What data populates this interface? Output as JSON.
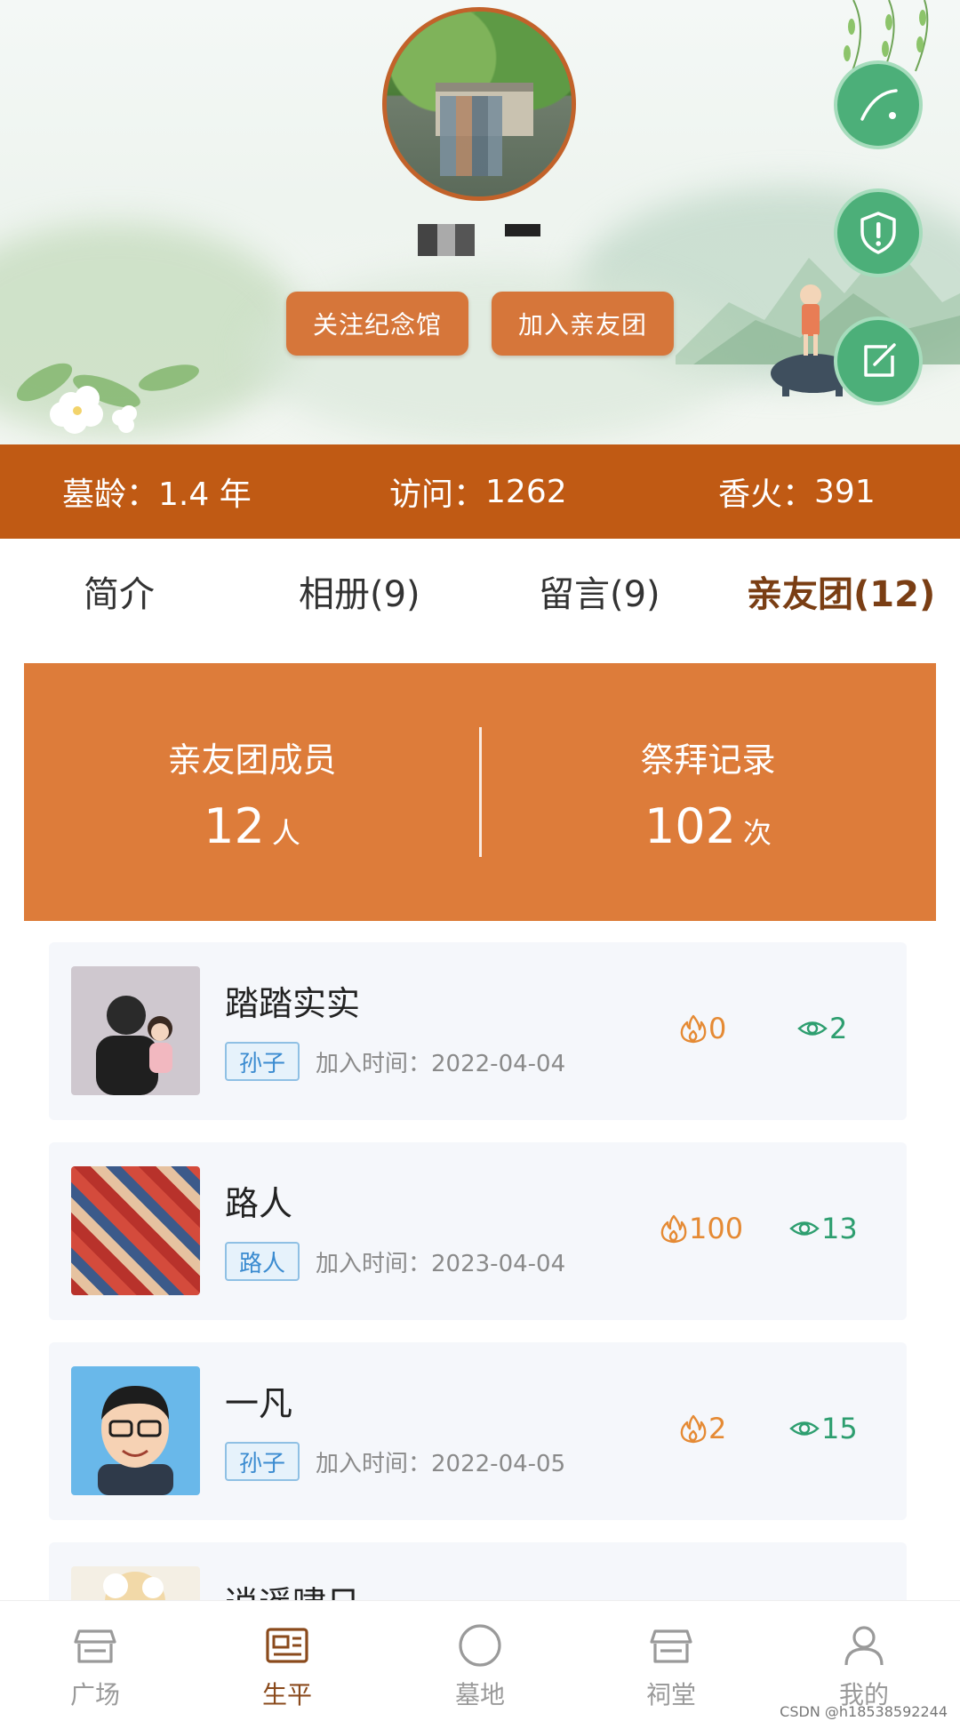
{
  "header": {
    "follow_button": "关注纪念馆",
    "join_button": "加入亲友团"
  },
  "stats": [
    {
      "label": "墓龄：",
      "value": "1.4 年"
    },
    {
      "label": "访问：",
      "value": "1262"
    },
    {
      "label": "香火：",
      "value": "391"
    }
  ],
  "tabs": [
    {
      "label": "简介"
    },
    {
      "label": "相册(9)"
    },
    {
      "label": "留言(9)"
    },
    {
      "label": "亲友团(12)",
      "active": true
    }
  ],
  "summary": {
    "members_label": "亲友团成员",
    "members_value": "12",
    "members_unit": "人",
    "records_label": "祭拜记录",
    "records_value": "102",
    "records_unit": "次"
  },
  "members": [
    {
      "name": "踏踏实实",
      "relation": "孙子",
      "join_prefix": "加入时间：",
      "join_date": "2022-04-04",
      "incense": "0",
      "views": "2"
    },
    {
      "name": "路人",
      "relation": "路人",
      "join_prefix": "加入时间：",
      "join_date": "2023-04-04",
      "incense": "100",
      "views": "13"
    },
    {
      "name": "一凡",
      "relation": "孙子",
      "join_prefix": "加入时间：",
      "join_date": "2022-04-05",
      "incense": "2",
      "views": "15"
    },
    {
      "name": "逍遥啸日"
    }
  ],
  "nav": [
    {
      "label": "广场",
      "icon": "shop-icon"
    },
    {
      "label": "生平",
      "icon": "id-card-icon",
      "active": true
    },
    {
      "label": "墓地",
      "icon": "circle-icon"
    },
    {
      "label": "祠堂",
      "icon": "shop-icon"
    },
    {
      "label": "我的",
      "icon": "user-icon"
    }
  ],
  "watermark": "CSDN @h18538592244",
  "colors": {
    "brand_orange": "#c05a14",
    "button_orange": "#d6763a",
    "summary_orange": "#dd7c3a",
    "active_tab": "#7a3e14",
    "fab_green": "#4caf79",
    "incense": "#e58a34",
    "views": "#2d9e6f",
    "tag_blue": "#3a8bd0"
  }
}
